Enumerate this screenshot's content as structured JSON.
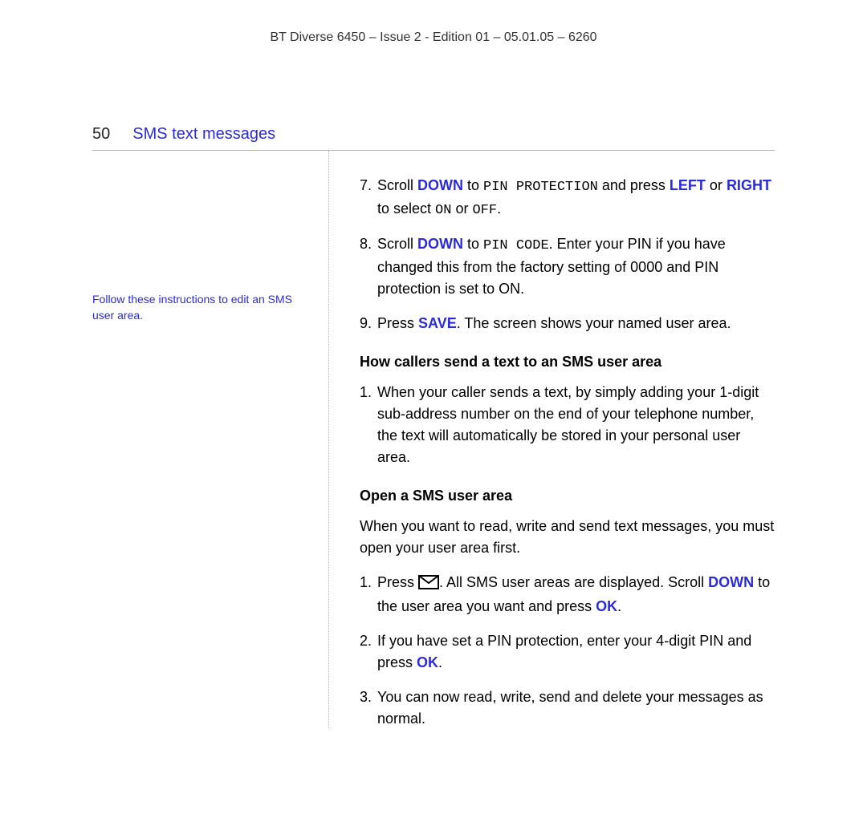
{
  "doc_header": "BT Diverse 6450 – Issue 2 - Edition 01 – 05.01.05 – 6260",
  "page_no": "50",
  "section_title": "SMS text messages",
  "margin_note": "Follow these instructions to edit an SMS user area.",
  "step7_num": "7.",
  "step7_a": "Scroll ",
  "step7_down": "DOWN",
  "step7_b": " to ",
  "step7_pin_protection": "PIN PROTECTION",
  "step7_c": " and press ",
  "step7_left": "LEFT",
  "step7_d": " or ",
  "step7_right": "RIGHT",
  "step7_e": " to select ",
  "step7_on": "ON",
  "step7_f": " or ",
  "step7_off": "OFF",
  "step7_g": ".",
  "step8_num": "8.",
  "step8_a": "Scroll ",
  "step8_down": "DOWN",
  "step8_b": " to ",
  "step8_pincode": "PIN CODE",
  "step8_c": ". Enter your PIN if you have changed this from the factory setting of 0000 and PIN protection is set to ON.",
  "step9_num": "9.",
  "step9_a": "Press ",
  "step9_save": "SAVE",
  "step9_b": ". The screen shows your named user area.",
  "subhead1": "How callers send a text to an SMS user area",
  "howstep1_num": "1.",
  "howstep1_text": "When your caller sends a text, by simply adding your 1-digit sub-address number on the end of your telephone number, the text will automatically be stored in your personal user area.",
  "subhead2": "Open a SMS user area",
  "open_intro": "When you want to read, write and send text messages, you must open your user area first.",
  "openstep1_num": "1.",
  "openstep1_a": "Press ",
  "openstep1_b": ". All SMS user areas are displayed. Scroll ",
  "openstep1_down": "DOWN",
  "openstep1_c": " to the user area you want and press ",
  "openstep1_ok": "OK",
  "openstep1_d": ".",
  "openstep2_num": "2.",
  "openstep2_a": "If you have set a PIN protection, enter your 4-digit PIN and press ",
  "openstep2_ok": "OK",
  "openstep2_b": ".",
  "openstep3_num": "3.",
  "openstep3_text": "You can now read, write, send and delete your messages as normal."
}
